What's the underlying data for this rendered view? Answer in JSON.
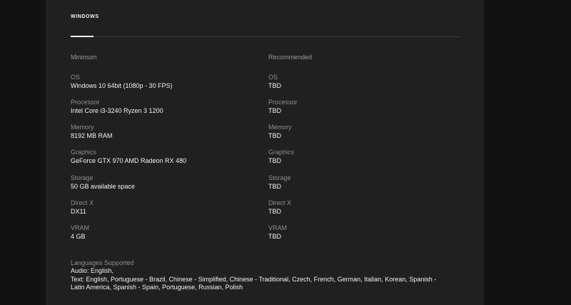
{
  "tab": {
    "label": "WINDOWS"
  },
  "minimum": {
    "header": "Minimum",
    "specs": [
      {
        "label": "OS",
        "value": "Windows 10 64bit (1080p - 30 FPS)"
      },
      {
        "label": "Processor",
        "value": "Intel Core i3-3240 Ryzen 3 1200"
      },
      {
        "label": "Memory",
        "value": "8192 MB RAM"
      },
      {
        "label": "Graphics",
        "value": "GeForce GTX 970 AMD Radeon RX 480"
      },
      {
        "label": "Storage",
        "value": "50 GB available space"
      },
      {
        "label": "Direct X",
        "value": "DX11"
      },
      {
        "label": "VRAM",
        "value": "4 GB"
      }
    ]
  },
  "recommended": {
    "header": "Recommended",
    "specs": [
      {
        "label": "OS",
        "value": "TBD"
      },
      {
        "label": "Processor",
        "value": "TBD"
      },
      {
        "label": "Memory",
        "value": "TBD"
      },
      {
        "label": "Graphics",
        "value": "TBD"
      },
      {
        "label": "Storage",
        "value": "TBD"
      },
      {
        "label": "Direct X",
        "value": "TBD"
      },
      {
        "label": "VRAM",
        "value": "TBD"
      }
    ]
  },
  "languages": {
    "title": "Languages Supported",
    "audio": "Audio: English,",
    "text_line1": "Text: English, Portuguese - Brazil, Chinese - Simplified, Chinese - Traditional, Czech, French, German, Italian, Korean, Spanish -",
    "text_line2": "Latin America, Spanish - Spain, Portuguese, Russian, Polish"
  },
  "colors": {
    "page_background": "#121212",
    "panel_background": "#202020",
    "label_text": "#8e8e8e",
    "value_text": "#f2f2f2",
    "divider": "#3a3a3a"
  }
}
